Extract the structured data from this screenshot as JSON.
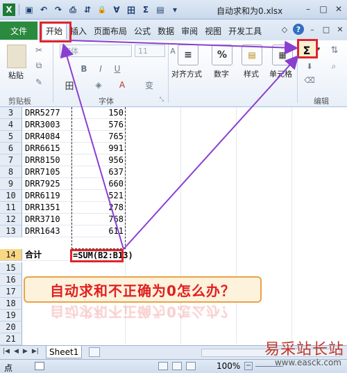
{
  "titlebar": {
    "title": "自动求和为0.xlsx",
    "qat_icons": [
      "excel-logo-icon",
      "save-icon",
      "undo-icon",
      "redo-icon",
      "print-preview-icon",
      "sort-icon",
      "lock-icon",
      "filter-icon",
      "borders-icon",
      "autosum-icon",
      "form-icon",
      "customize-qat-icon"
    ],
    "qat_glyphs": [
      "X",
      "▣",
      "↶",
      "↷",
      "⎙",
      "⇵",
      "🔒",
      "∀",
      "田",
      "Σ",
      "▤",
      "▾"
    ],
    "window_buttons": [
      "–",
      "□",
      "✕"
    ]
  },
  "ribbon_tabs": {
    "file": "文件",
    "tabs": [
      "开始",
      "插入",
      "页面布局",
      "公式",
      "数据",
      "审阅",
      "视图",
      "开发工具"
    ],
    "active": "开始",
    "right_icons": [
      "◇",
      "?",
      "–",
      "□",
      "✕"
    ]
  },
  "ribbon": {
    "paste_label": "粘贴",
    "clipboard_label": "剪贴板",
    "font_name": "宋体",
    "font_size": "11",
    "bold": "B",
    "italic": "I",
    "underline": "U",
    "font_group_label": "字体",
    "align_label": "对齐方式",
    "number_label": "数字",
    "style_label": "样式",
    "cells_label": "单元格",
    "editing_label": "编辑",
    "autosum_glyph": "Σ",
    "percent_glyph": "%",
    "font_grow": "A",
    "font_color_glyph": "A",
    "phonetic_glyph": "变"
  },
  "sheet": {
    "rows": [
      {
        "num": "3",
        "a": "DRR5277",
        "b": "150"
      },
      {
        "num": "4",
        "a": "DRR3003",
        "b": "576"
      },
      {
        "num": "5",
        "a": "DRR4084",
        "b": "765"
      },
      {
        "num": "6",
        "a": "DRR6615",
        "b": "991"
      },
      {
        "num": "7",
        "a": "DRR8150",
        "b": "956"
      },
      {
        "num": "8",
        "a": "DRR7105",
        "b": "637"
      },
      {
        "num": "9",
        "a": "DRR7925",
        "b": "660"
      },
      {
        "num": "10",
        "a": "DRR6119",
        "b": "521"
      },
      {
        "num": "11",
        "a": "DRR1351",
        "b": "278"
      },
      {
        "num": "12",
        "a": "DRR3710",
        "b": "768"
      },
      {
        "num": "13",
        "a": "DRR1643",
        "b": "611"
      }
    ],
    "total_row": {
      "num": "14",
      "label": "合计",
      "formula": "=SUM(B2:B13)"
    },
    "empty_rows": [
      "15",
      "16",
      "17",
      "18",
      "19",
      "20",
      "21"
    ],
    "banner_text": "自动求和不正确为0怎么办？"
  },
  "sheetbar": {
    "nav": [
      "|◀",
      "◀",
      "▶",
      "▶|"
    ],
    "sheet_tab": "Sheet1"
  },
  "statusbar": {
    "ready": "点",
    "zoom": "100%",
    "zoom_minus": "−"
  },
  "watermark": {
    "cn": "易采站长站",
    "url": "www.easck.com"
  },
  "colors": {
    "file_tab": "#2a8a3e",
    "highlight": "#e0242a",
    "arrow": "#8a3fd1",
    "banner_text": "#e02020",
    "selected_row": "#f8d882"
  }
}
